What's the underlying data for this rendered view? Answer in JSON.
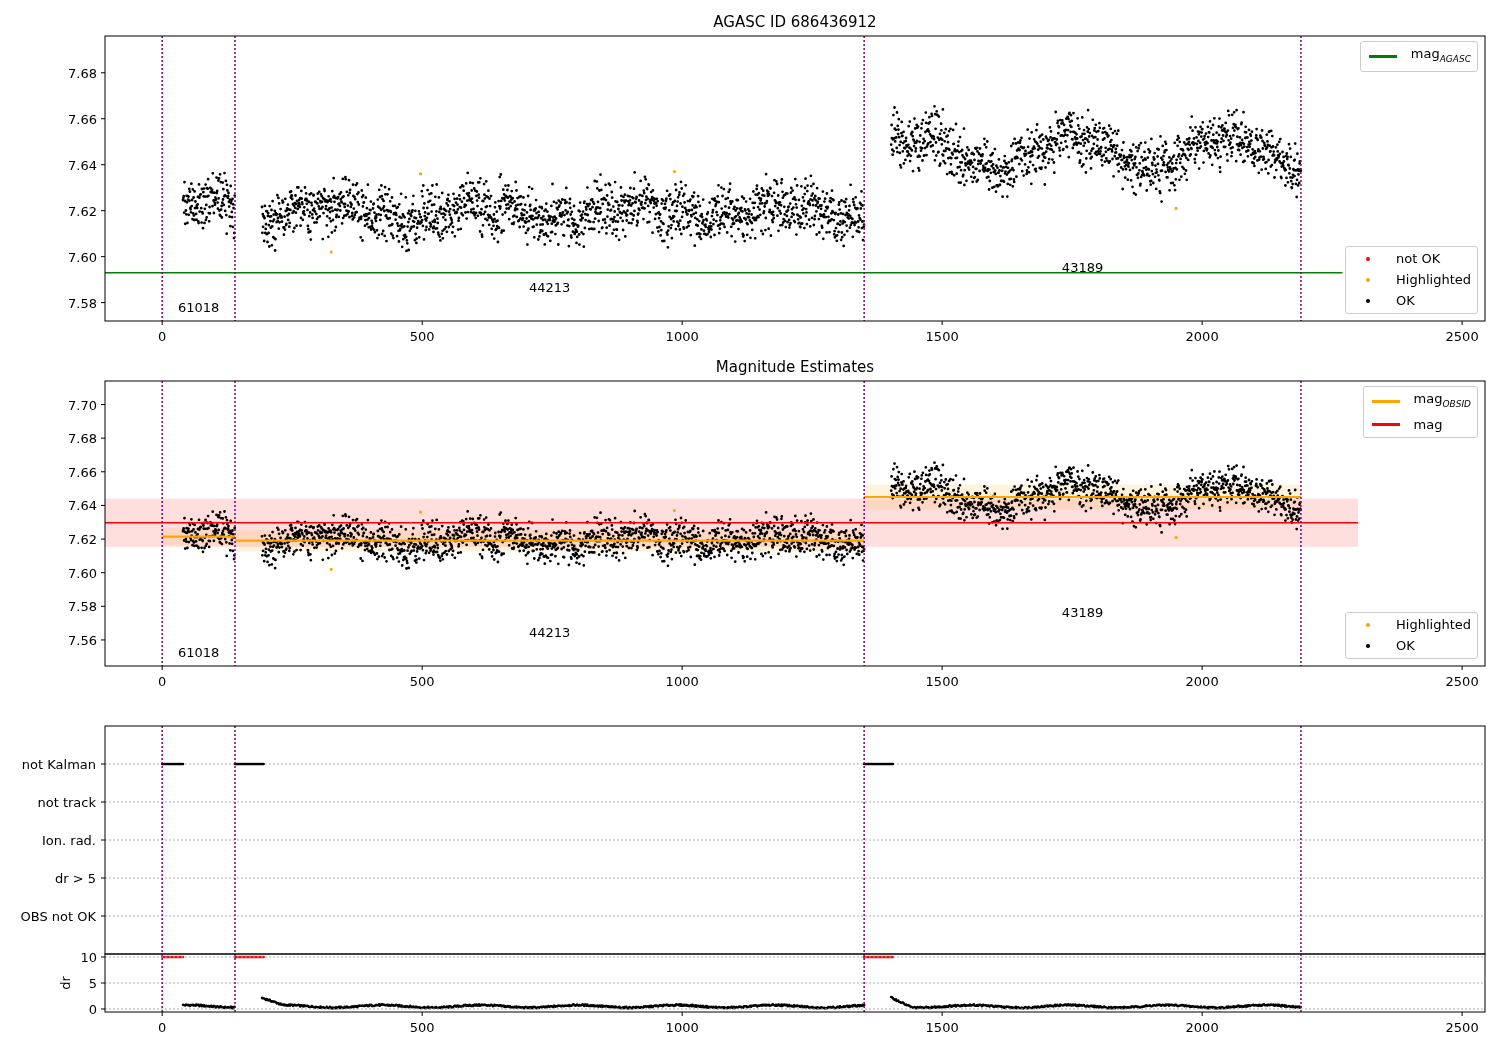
{
  "agasc_panel": {
    "chart_data": {
      "type": "scatter",
      "title": "AGASC ID 686436912",
      "xlim": [
        -110,
        2544
      ],
      "ylim": [
        7.572,
        7.696
      ],
      "xticks": [
        0,
        500,
        1000,
        1500,
        2000,
        2500
      ],
      "yticks": [
        {
          "value": 7.58,
          "label": "7.58"
        },
        {
          "value": 7.6,
          "label": "7.60"
        },
        {
          "value": 7.62,
          "label": "7.62"
        },
        {
          "value": 7.64,
          "label": "7.64"
        },
        {
          "value": 7.66,
          "label": "7.66"
        },
        {
          "value": 7.68,
          "label": "7.68"
        }
      ],
      "series": [
        {
          "type": "line",
          "color": "#008000",
          "x": [
            -110,
            2270
          ],
          "values": [
            7.593,
            7.593
          ]
        }
      ],
      "ref_lines": [
        {
          "axis": "x",
          "value": 0,
          "color": "#800080"
        },
        {
          "axis": "x",
          "value": 140,
          "color": "#800080"
        },
        {
          "axis": "x",
          "value": 1350,
          "color": "#800080"
        },
        {
          "axis": "x",
          "value": 2190,
          "color": "#800080"
        }
      ],
      "annotations": [
        "61018",
        "44213",
        "43189"
      ]
    },
    "legends": {
      "upper": [
        {
          "label": "mag$_{AGASC}$",
          "kind": "line",
          "color": "#008000"
        }
      ],
      "lower": [
        {
          "label": "not OK",
          "kind": "dot",
          "color": "#ff0000"
        },
        {
          "label": "Highlighted",
          "kind": "dot",
          "color": "#ffa500"
        },
        {
          "label": "OK",
          "kind": "dot",
          "color": "#000000"
        }
      ]
    }
  },
  "estimates_panel": {
    "error_bands": true,
    "chart_data": {
      "type": "scatter",
      "title": "Magnitude Estimates",
      "xlim": [
        -110,
        2544
      ],
      "ylim": [
        7.5445,
        7.714
      ],
      "xticks": [
        0,
        500,
        1000,
        1500,
        2000,
        2500
      ],
      "yticks": [
        {
          "value": 7.56,
          "label": "7.56"
        },
        {
          "value": 7.58,
          "label": "7.58"
        },
        {
          "value": 7.6,
          "label": "7.60"
        },
        {
          "value": 7.62,
          "label": "7.62"
        },
        {
          "value": 7.64,
          "label": "7.64"
        },
        {
          "value": 7.66,
          "label": "7.66"
        },
        {
          "value": 7.68,
          "label": "7.68"
        },
        {
          "value": 7.7,
          "label": "7.70"
        }
      ],
      "series": [
        {
          "type": "line",
          "color": "#ff0000",
          "x": [
            -110,
            2300
          ],
          "values": [
            7.6297,
            7.6297
          ]
        },
        {
          "type": "line",
          "color": "#ffa500",
          "x": [
            0,
            140
          ],
          "values": [
            7.6214,
            7.6214
          ]
        },
        {
          "type": "line",
          "color": "#ffa500",
          "x": [
            140,
            1350
          ],
          "values": [
            7.619,
            7.619
          ]
        },
        {
          "type": "line",
          "color": "#ffa500",
          "x": [
            1350,
            2190
          ],
          "values": [
            7.645,
            7.645
          ]
        }
      ],
      "ref_lines": [
        {
          "axis": "x",
          "value": 0,
          "color": "#800080"
        },
        {
          "axis": "x",
          "value": 140,
          "color": "#800080"
        },
        {
          "axis": "x",
          "value": 1350,
          "color": "#800080"
        },
        {
          "axis": "x",
          "value": 2190,
          "color": "#800080"
        }
      ],
      "annotations": [
        "61018",
        "44213",
        "43189"
      ]
    },
    "legends": {
      "upper": [
        {
          "label": "mag$_{OBSID}$",
          "kind": "line",
          "color": "#ffa500"
        },
        {
          "label": "mag",
          "kind": "line",
          "color": "#ff0000"
        }
      ],
      "lower": [
        {
          "label": "Highlighted",
          "kind": "dot",
          "color": "#ffa500"
        },
        {
          "label": "OK",
          "kind": "dot",
          "color": "#000000"
        }
      ]
    }
  },
  "flags_panel": {
    "flag_rows": [
      "not Kalman",
      "not track",
      "Ion. rad.",
      "dr > 5",
      "OBS not OK"
    ],
    "dr": {
      "chart_data": {
        "type": "scatter",
        "ylabel": "dr",
        "xlim": [
          -110,
          2544
        ],
        "ylim": [
          -0.58,
          10.58
        ],
        "xticks": [
          0,
          500,
          1000,
          1500,
          2000,
          2500
        ],
        "yticks": [
          0,
          5,
          10
        ],
        "grid": true,
        "ref_lines": [
          {
            "axis": "x",
            "value": 0,
            "color": "#800080"
          },
          {
            "axis": "x",
            "value": 140,
            "color": "#800080"
          },
          {
            "axis": "x",
            "value": 1350,
            "color": "#800080"
          },
          {
            "axis": "x",
            "value": 2190,
            "color": "#800080"
          }
        ]
      }
    }
  }
}
